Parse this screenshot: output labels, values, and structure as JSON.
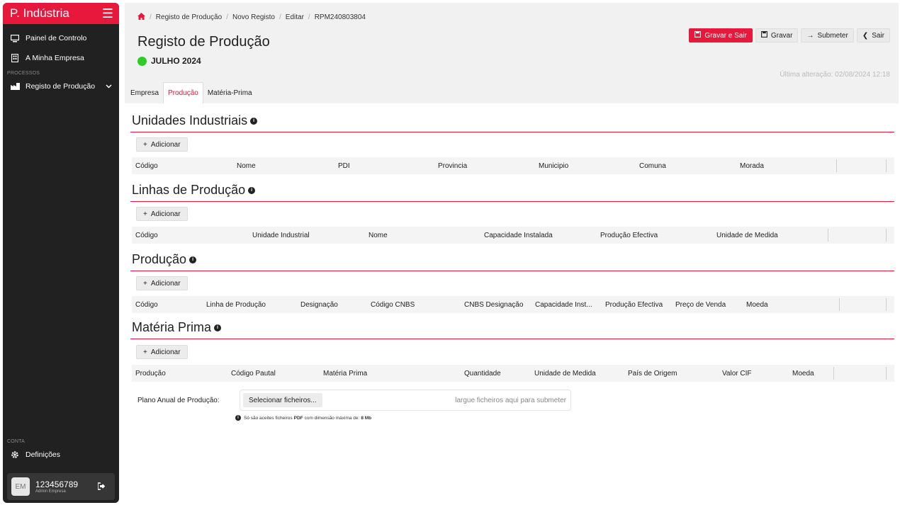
{
  "colors": {
    "accent": "#e8173c",
    "sidebar": "#212121",
    "status_green": "#2ecc27"
  },
  "sidebar": {
    "brand": "P. Indústria",
    "menu_icon": "hamburger-icon",
    "items": [
      {
        "label": "Painel de Controlo",
        "icon": "monitor-icon"
      },
      {
        "label": "A Minha Empresa",
        "icon": "building-icon"
      }
    ],
    "section_processos": "PROCESSOS",
    "process_items": [
      {
        "label": "Registo de Produção",
        "icon": "factory-icon",
        "chevron": "chevron-down-icon"
      }
    ],
    "section_conta": "CONTA",
    "account_items": [
      {
        "label": "Definições",
        "icon": "gear-icon"
      }
    ],
    "user": {
      "initials": "EM",
      "id": "123456789",
      "role": "Admin Empresa"
    }
  },
  "header": {
    "breadcrumb": [
      "Registo de Produção",
      "Novo Registo",
      "Editar",
      "RPM240803804"
    ],
    "title": "Registo de Produção",
    "period": "JULHO 2024",
    "last_change": "Última alteração: 02/08/2024 12:18",
    "buttons": {
      "save_exit": "Gravar e Sair",
      "save": "Gravar",
      "submit": "Submeter",
      "exit": "Sair"
    }
  },
  "tabs": [
    "Empresa",
    "Produção",
    "Matéria-Prima"
  ],
  "active_tab": "Produção",
  "add_label": "Adicionar",
  "sections": {
    "unidades": {
      "title": "Unidades Industriais",
      "columns": [
        "Código",
        "Nome",
        "PDI",
        "Provincia",
        "Municipio",
        "Comuna",
        "Morada"
      ]
    },
    "linhas": {
      "title": "Linhas de Produção",
      "columns": [
        "Código",
        "Unidade Industrial",
        "Nome",
        "Capacidade Instalada",
        "Produção Efectiva",
        "Unidade de Medida"
      ]
    },
    "producao": {
      "title": "Produção",
      "columns": [
        "Código",
        "Linha de Produção",
        "Designação",
        "Código CNBS",
        "CNBS Designação",
        "Capacidade Inst...",
        "Produção Efectiva",
        "Preço de Venda",
        "Moeda"
      ]
    },
    "materia": {
      "title": "Matéria Prima",
      "columns": [
        "Produção",
        "Código Pautal",
        "Matéria Prima",
        "Quantidade",
        "Unidade de Medida",
        "País de Origem",
        "Valor CIF",
        "Moeda"
      ]
    }
  },
  "upload": {
    "label": "Plano Anual de Produção:",
    "button": "Selecionar ficheiros...",
    "drop_text": "largue ficheiros aqui para submeter",
    "note_prefix": "Só são aceites ficheiros ",
    "note_type": "PDF",
    "note_middle": " com dimensão máxima de: ",
    "note_size": "8 Mb"
  }
}
